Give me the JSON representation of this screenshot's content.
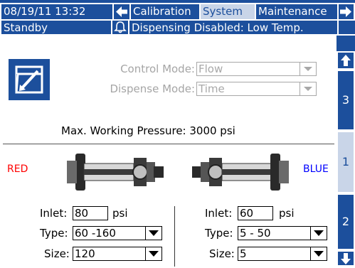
{
  "header": {
    "datetime": "08/19/11 13:32",
    "tabs": [
      {
        "label": "Calibration",
        "active": false
      },
      {
        "label": "System",
        "active": true
      },
      {
        "label": "Maintenance",
        "active": false
      }
    ],
    "status": "Standby",
    "alert": "Dispensing Disabled: Low Temp."
  },
  "settings": {
    "control_mode_label": "Control Mode:",
    "control_mode_value": "Flow",
    "dispense_mode_label": "Dispense Mode:",
    "dispense_mode_value": "Time",
    "max_pressure": "Max. Working Pressure:  3000 psi"
  },
  "pumps": {
    "red_label": "RED",
    "blue_label": "BLUE",
    "left": {
      "inlet_label": "Inlet:",
      "inlet_value": "80",
      "unit": "psi",
      "type_label": "Type:",
      "type_value": "60 -160",
      "size_label": "Size:",
      "size_value": "120"
    },
    "right": {
      "inlet_label": "Inlet:",
      "inlet_value": "60",
      "unit": "psi",
      "type_label": "Type:",
      "type_value": "5 - 50",
      "size_label": "Size:",
      "size_value": "5"
    }
  },
  "sidebar": {
    "pages": [
      {
        "label": "3",
        "active": false
      },
      {
        "label": "1",
        "active": true
      },
      {
        "label": "2",
        "active": false
      }
    ]
  },
  "colors": {
    "brand": "#1c4f9c",
    "active_tab": "#c9d5e8",
    "red_label": "#ff0000",
    "blue_label": "#0000ff"
  }
}
